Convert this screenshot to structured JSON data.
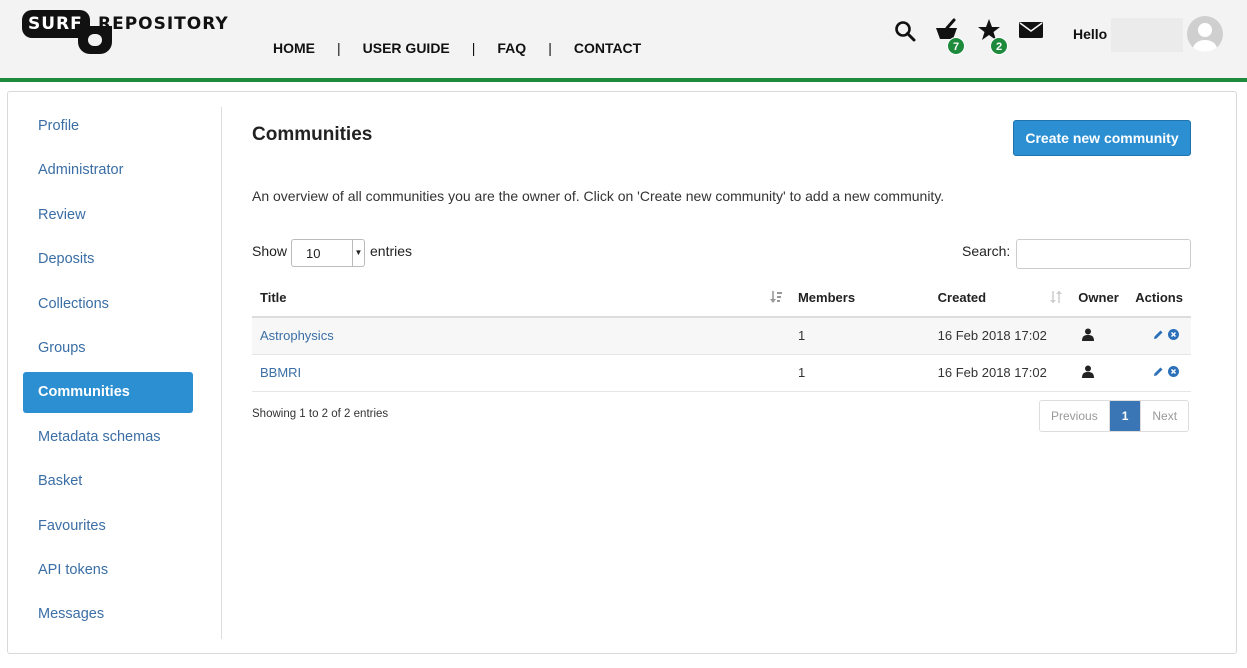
{
  "brand": {
    "logo_surf": "SURF",
    "logo_repository": "REPOSITORY",
    "green": "#1e8a3c",
    "accent": "#2b8fd2"
  },
  "topnav": {
    "items": [
      "HOME",
      "USER GUIDE",
      "FAQ",
      "CONTACT"
    ],
    "separator": "|"
  },
  "header_icons": {
    "search": "search-icon",
    "basket": {
      "icon": "basket-icon",
      "count": "7"
    },
    "favourites": {
      "icon": "star-icon",
      "count": "2"
    },
    "messages": "envelope-icon",
    "greeting": "Hello"
  },
  "sidebar": {
    "items": [
      {
        "label": "Profile"
      },
      {
        "label": "Administrator"
      },
      {
        "label": "Review"
      },
      {
        "label": "Deposits"
      },
      {
        "label": "Collections"
      },
      {
        "label": "Groups"
      },
      {
        "label": "Communities",
        "active": true
      },
      {
        "label": "Metadata schemas"
      },
      {
        "label": "Basket"
      },
      {
        "label": "Favourites"
      },
      {
        "label": "API tokens"
      },
      {
        "label": "Messages"
      }
    ]
  },
  "main": {
    "title": "Communities",
    "create_button": "Create new community",
    "intro": "An overview of all communities you are the owner of. Click on 'Create new community' to add a new community.",
    "show_label": "Show",
    "entries_value": "10",
    "entries_label": "entries",
    "search_label": "Search:",
    "search_value": ""
  },
  "table": {
    "columns": [
      "Title",
      "Members",
      "Created",
      "Owner",
      "Actions"
    ],
    "rows": [
      {
        "title": "Astrophysics",
        "members": "1",
        "created": "16 Feb 2018 17:02",
        "owner_icon": "user-icon",
        "actions": [
          "edit-icon",
          "delete-icon"
        ]
      },
      {
        "title": "BBMRI",
        "members": "1",
        "created": "16 Feb 2018 17:02",
        "owner_icon": "user-icon",
        "actions": [
          "edit-icon",
          "delete-icon"
        ]
      }
    ]
  },
  "footer": {
    "showing": "Showing 1 to 2 of 2 entries",
    "previous": "Previous",
    "page": "1",
    "next": "Next"
  }
}
